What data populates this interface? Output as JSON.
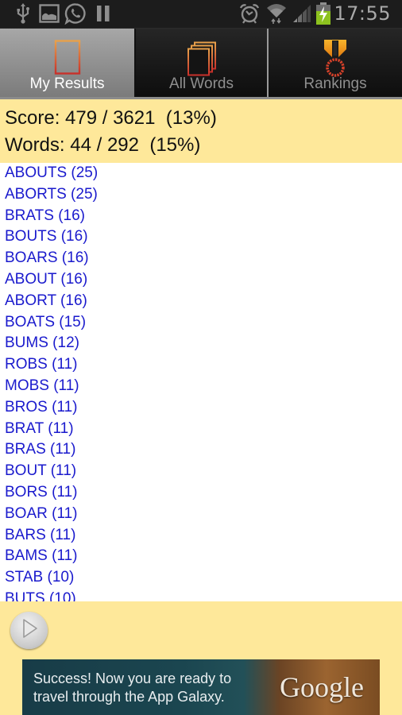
{
  "status_bar": {
    "left_icons": [
      "usb-icon",
      "gallery-icon",
      "whatsapp-icon",
      "pause-icon"
    ],
    "right_icons": [
      "alarm-icon",
      "wifi-icon",
      "signal-icon",
      "battery-charging-icon"
    ],
    "time": "17:55"
  },
  "tabs": [
    {
      "label": "My Results",
      "icon": "document-icon",
      "active": true
    },
    {
      "label": "All Words",
      "icon": "documents-stack-icon",
      "active": false
    },
    {
      "label": "Rankings",
      "icon": "medal-icon",
      "active": false
    }
  ],
  "summary": {
    "score": "Score: 479 / 3621  (13%)",
    "words": "Words: 44 / 292  (15%)"
  },
  "words": [
    "ABOUTS (25)",
    "ABORTS (25)",
    "BRATS (16)",
    "BOUTS (16)",
    "BOARS (16)",
    "ABOUT (16)",
    "ABORT (16)",
    "BOATS (15)",
    "BUMS (12)",
    "ROBS (11)",
    "MOBS (11)",
    "BROS (11)",
    "BRAT (11)",
    "BRAS (11)",
    "BOUT (11)",
    "BORS (11)",
    "BOAR (11)",
    "BARS (11)",
    "BAMS (11)",
    "STAB (10)",
    "BUTS (10)"
  ],
  "play_button": {
    "icon": "play-icon"
  },
  "ad": {
    "line1": "Success! Now you are ready to",
    "line2": "travel through the App Galaxy.",
    "brand": "Google"
  },
  "colors": {
    "accent_yellow": "#fee89a",
    "word_link": "#1a1acd",
    "tab_active": "#9a9a9a",
    "statusbar": "#1c1c1c"
  }
}
